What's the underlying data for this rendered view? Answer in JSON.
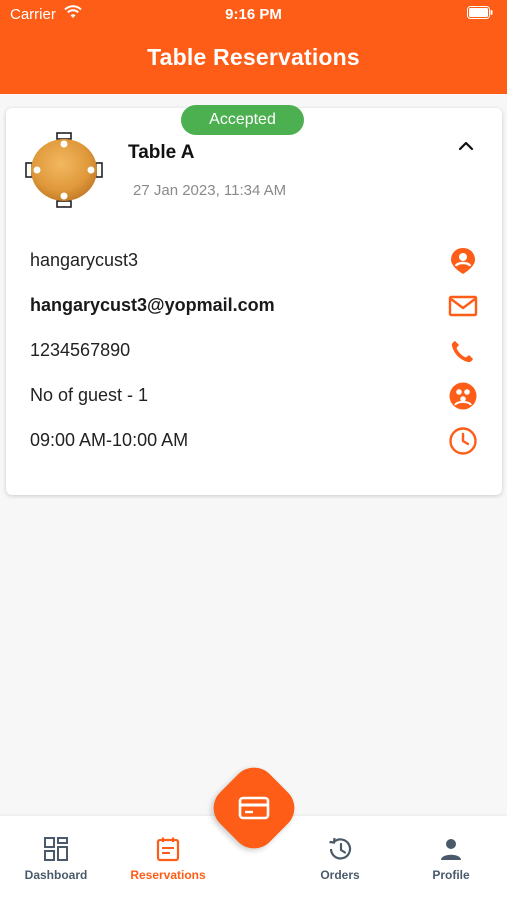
{
  "status_bar": {
    "carrier": "Carrier",
    "time": "9:16 PM"
  },
  "header": {
    "title": "Table Reservations"
  },
  "reservation": {
    "status": "Accepted",
    "table_name": "Table A",
    "date": "27 Jan 2023, 11:34 AM",
    "customer_name": "hangarycust3",
    "email": "hangarycust3@yopmail.com",
    "phone": "1234567890",
    "guests": "No of guest  -  1",
    "time_slot": "09:00 AM-10:00 AM"
  },
  "bottom_nav": {
    "items": [
      {
        "label": "Dashboard",
        "icon": "dashboard-icon"
      },
      {
        "label": "Reservations",
        "icon": "calendar-icon"
      },
      {
        "label": "Orders",
        "icon": "history-icon"
      },
      {
        "label": "Profile",
        "icon": "person-icon"
      }
    ],
    "fab_icon": "card-icon"
  },
  "colors": {
    "accent": "#fe5d17",
    "status_accepted": "#4caf50",
    "nav_inactive": "#4a5a6a"
  }
}
